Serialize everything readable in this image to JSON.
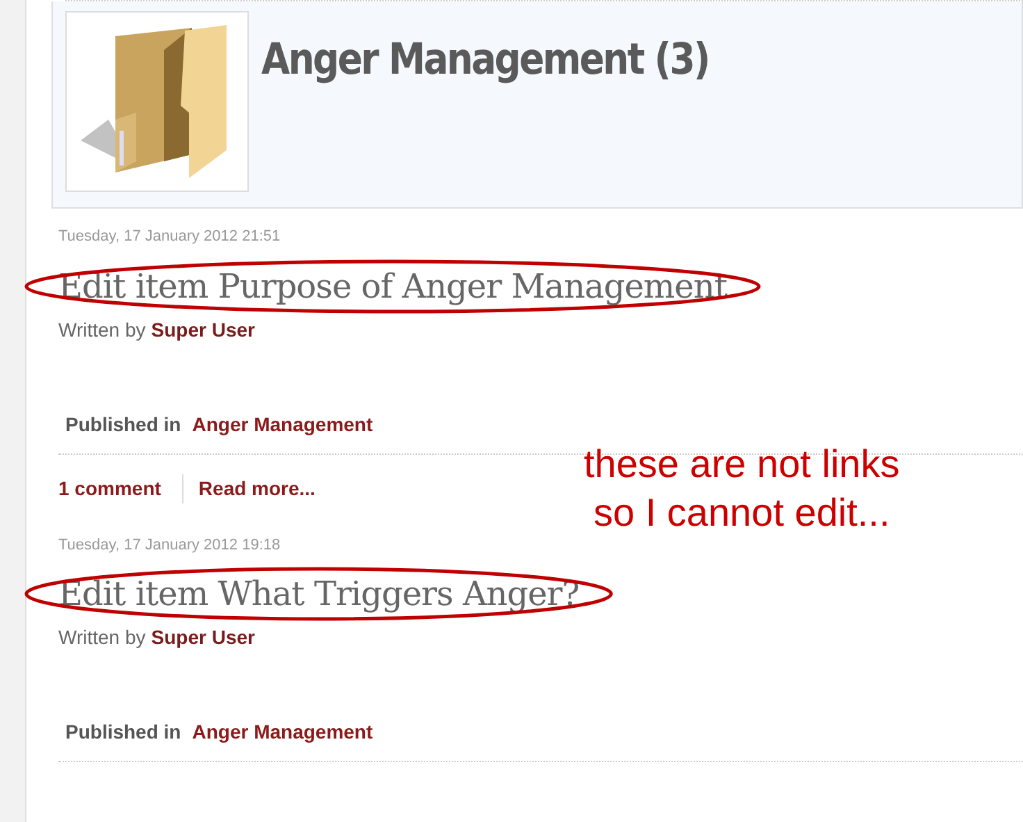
{
  "category": {
    "title": "Anger Management (3)"
  },
  "articles": [
    {
      "date": "Tuesday, 17 January 2012 21:51",
      "title": "Edit item Purpose of Anger Management",
      "written_by_label": "Written by",
      "author": "Super User",
      "published_label": "Published in",
      "category": "Anger Management",
      "comments": "1 comment",
      "read_more": "Read more...",
      "circled": true
    },
    {
      "date": "Tuesday, 17 January 2012 19:18",
      "title": "Edit item What Triggers Anger?",
      "written_by_label": "Written by",
      "author": "Super User",
      "published_label": "Published in",
      "category": "Anger Management",
      "circled": true
    }
  ],
  "note": {
    "lines": [
      "these are not links",
      "so I cannot edit..."
    ]
  }
}
